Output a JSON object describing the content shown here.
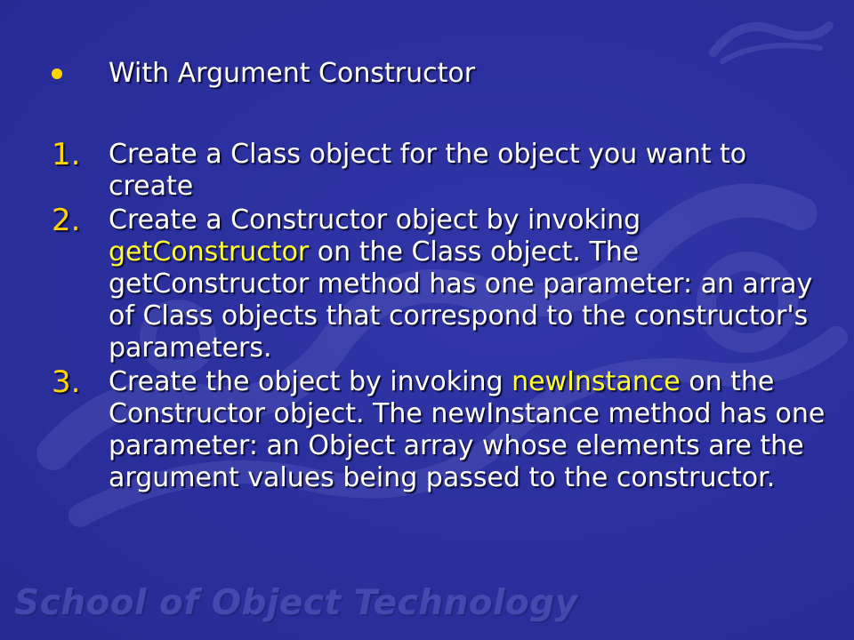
{
  "footer": {
    "brand": "School of Object Technology"
  },
  "colors": {
    "background": "#2b2f9d",
    "bullet": "#ffd400",
    "highlight": "#ffff33",
    "text": "#ffffff"
  },
  "heading": {
    "bullet_icon": "bullet-dot",
    "text": "With Argument Constructor"
  },
  "steps": [
    {
      "number": "1.",
      "parts": [
        "Create a Class object for the object you want to create"
      ]
    },
    {
      "number": "2.",
      "parts": [
        "Create a Constructor object by invoking ",
        "getConstructor",
        " on the Class object. The getConstructor method has one parameter: an array of Class objects that correspond to the constructor's parameters."
      ]
    },
    {
      "number": "3.",
      "parts": [
        "Create the object by invoking ",
        "newInstance",
        " on the Constructor object. The newInstance method has one parameter: an Object array whose elements are the argument values being passed to the constructor."
      ]
    }
  ]
}
